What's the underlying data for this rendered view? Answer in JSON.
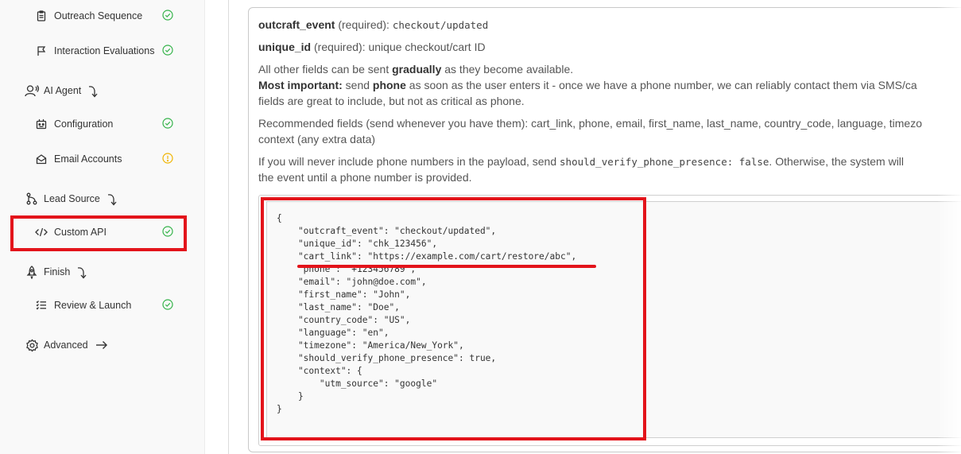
{
  "sidebar": {
    "items": [
      {
        "label": "Outreach Sequence",
        "icon": "clipboard-icon",
        "status": "check"
      },
      {
        "label": "Interaction Evaluations",
        "icon": "flag-icon",
        "status": "check"
      },
      {
        "label": "AI Agent",
        "icon": "agent-icon"
      },
      {
        "label": "Configuration",
        "icon": "configuration-icon",
        "status": "check"
      },
      {
        "label": "Email Accounts",
        "icon": "mail-open-icon",
        "status": "warning"
      },
      {
        "label": "Lead Source",
        "icon": "lead-source-icon"
      },
      {
        "label": "Custom API",
        "icon": "code-icon",
        "status": "check"
      },
      {
        "label": "Finish",
        "icon": "rocket-icon"
      },
      {
        "label": "Review & Launch",
        "icon": "list-check-icon",
        "status": "check"
      },
      {
        "label": "Advanced",
        "icon": "gear-icon"
      }
    ]
  },
  "main": {
    "event_field": {
      "name": "outcraft_event",
      "required": " (required): ",
      "value": "checkout/updated"
    },
    "id_field": {
      "name": "unique_id",
      "required": " (required): ",
      "value": "unique checkout/cart ID"
    },
    "gradual": {
      "pre": "All other fields can be sent ",
      "bold": "gradually",
      "post": " as they become available."
    },
    "important": {
      "bold": "Most important:",
      "pre": " send ",
      "bold2": "phone",
      "post": " as soon as the user enters it - once we have a phone number, we can reliably contact them via SMS/ca"
    },
    "important_2": "fields are great to include, but not as critical as phone.",
    "recommended_1": "Recommended fields (send whenever you have them): cart_link, phone, email, first_name, last_name, country_code, language, timezo",
    "recommended_2": "context (any extra data)",
    "verify_1": {
      "pre": "If you will never include phone numbers in the payload, send ",
      "code": "should_verify_phone_presence: false",
      "post": ". Otherwise, the system will"
    },
    "verify_2": "the event until a phone number is provided.",
    "code_lines": [
      "{",
      "    \"outcraft_event\": \"checkout/updated\",",
      "    \"unique_id\": \"chk_123456\",",
      "    \"cart_link\": \"https://example.com/cart/restore/abc\",",
      "    \"phone\": \"+123456789\",",
      "    \"email\": \"john@doe.com\",",
      "    \"first_name\": \"John\",",
      "    \"last_name\": \"Doe\",",
      "    \"country_code\": \"US\",",
      "    \"language\": \"en\",",
      "    \"timezone\": \"America/New_York\",",
      "    \"should_verify_phone_presence\": true,",
      "    \"context\": {",
      "        \"utm_source\": \"google\"",
      "    }",
      "}"
    ]
  },
  "colors": {
    "highlight": "#e3141b",
    "success": "#35b34a",
    "warning": "#f0b400"
  }
}
